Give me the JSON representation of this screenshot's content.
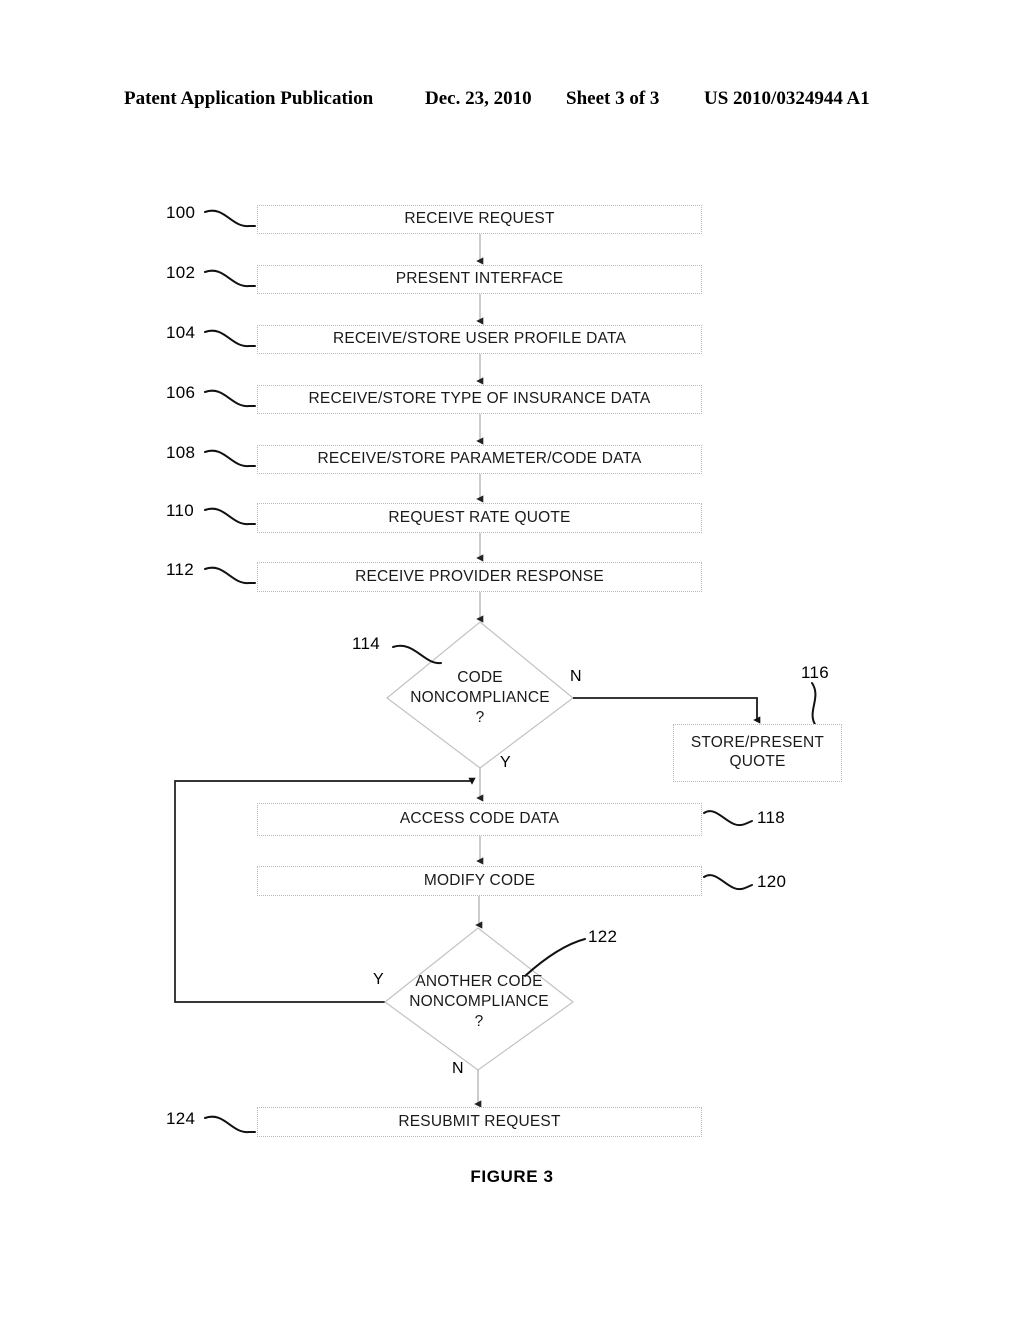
{
  "header": {
    "publication": "Patent Application Publication",
    "date": "Dec. 23, 2010",
    "sheet": "Sheet 3 of 3",
    "document_number": "US 2010/0324944 A1"
  },
  "figure": {
    "caption": "FIGURE 3",
    "title": "FIGURE 3"
  },
  "flowchart": {
    "steps": [
      {
        "ref": "100",
        "label": "RECEIVE REQUEST",
        "shape": "process"
      },
      {
        "ref": "102",
        "label": "PRESENT INTERFACE",
        "shape": "process"
      },
      {
        "ref": "104",
        "label": "RECEIVE/STORE USER PROFILE DATA",
        "shape": "process"
      },
      {
        "ref": "106",
        "label": "RECEIVE/STORE TYPE OF INSURANCE DATA",
        "shape": "process"
      },
      {
        "ref": "108",
        "label": "RECEIVE/STORE PARAMETER/CODE DATA",
        "shape": "process"
      },
      {
        "ref": "110",
        "label": "REQUEST RATE QUOTE",
        "shape": "process"
      },
      {
        "ref": "112",
        "label": "RECEIVE PROVIDER RESPONSE",
        "shape": "process"
      }
    ],
    "decision_1": {
      "ref": "114",
      "line1": "CODE",
      "line2": "NONCOMPLIANCE",
      "line3": "?",
      "branch_no": "N",
      "branch_yes": "Y"
    },
    "quote_box": {
      "ref": "116",
      "line1": "STORE/PRESENT",
      "line2": "QUOTE"
    },
    "access_code": {
      "ref": "118",
      "label": "ACCESS CODE DATA"
    },
    "modify_code": {
      "ref": "120",
      "label": "MODIFY CODE"
    },
    "decision_2": {
      "ref": "122",
      "line1": "ANOTHER CODE",
      "line2": "NONCOMPLIANCE",
      "line3": "?",
      "branch_yes": "Y",
      "branch_no": "N"
    },
    "resubmit": {
      "ref": "124",
      "label": "RESUBMIT REQUEST"
    }
  },
  "colors": {
    "ink": "#000000",
    "box_border": "#b9b9b9",
    "connector": "#a8a8a8",
    "solid_line": "#1a1a1a",
    "background": "#ffffff"
  }
}
